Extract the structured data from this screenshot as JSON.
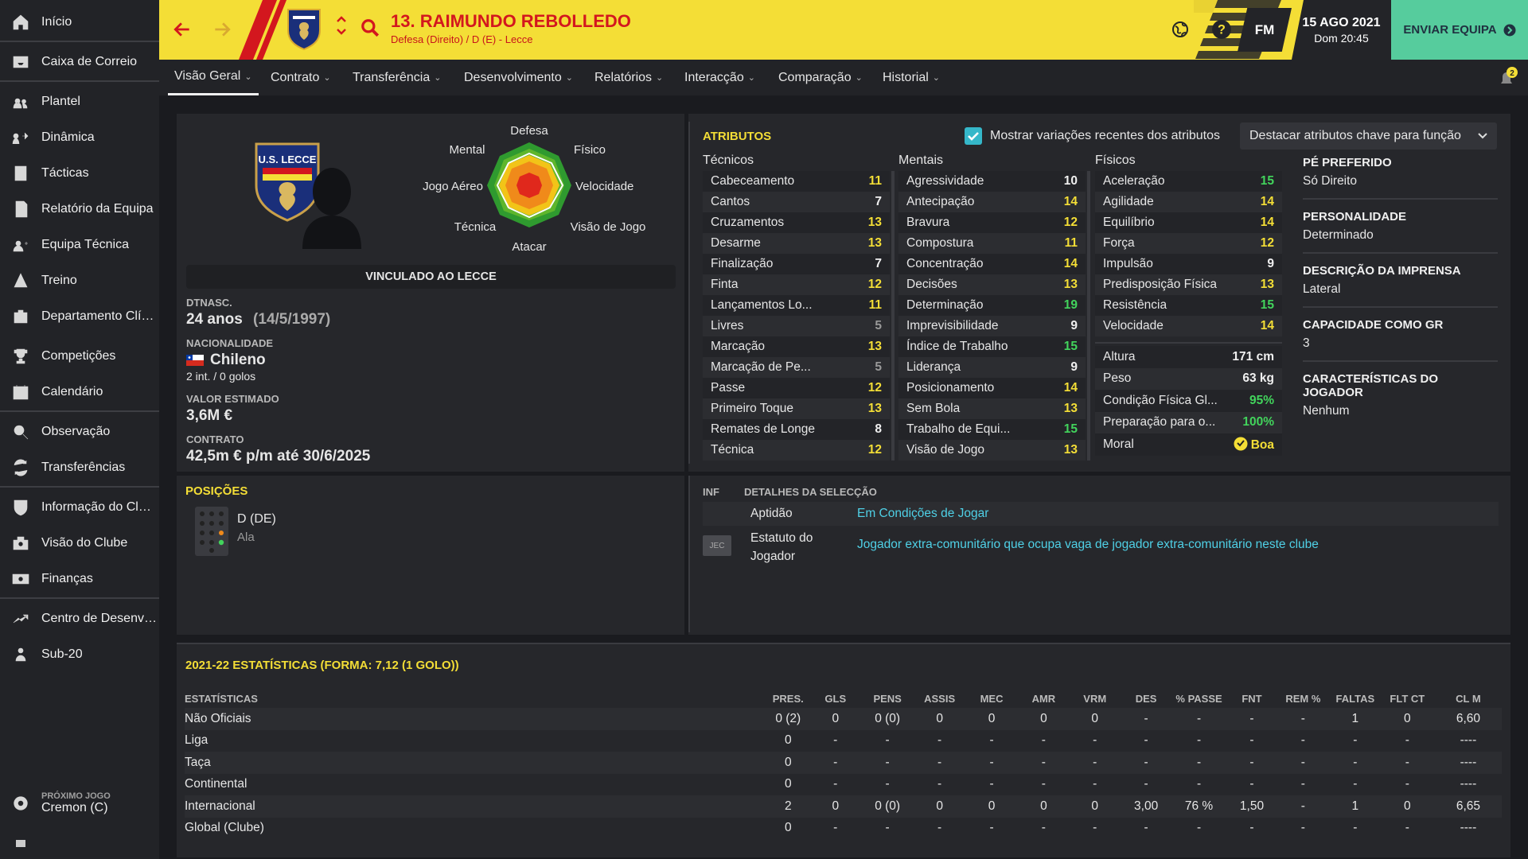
{
  "sidebar": {
    "items": [
      {
        "label": "Início",
        "icon": "home-icon"
      },
      {
        "label": "Caixa de Correio",
        "icon": "inbox-icon"
      },
      {
        "label": "Plantel",
        "icon": "squad-icon"
      },
      {
        "label": "Dinâmica",
        "icon": "dynamics-icon"
      },
      {
        "label": "Tácticas",
        "icon": "tactics-icon"
      },
      {
        "label": "Relatório da Equipa",
        "icon": "report-icon"
      },
      {
        "label": "Equipa Técnica",
        "icon": "staff-icon"
      },
      {
        "label": "Treino",
        "icon": "training-icon"
      },
      {
        "label": "Departamento Clíni...",
        "icon": "medical-icon"
      },
      {
        "label": "Competições",
        "icon": "trophy-icon"
      },
      {
        "label": "Calendário",
        "icon": "calendar-icon"
      },
      {
        "label": "Observação",
        "icon": "scouting-icon"
      },
      {
        "label": "Transferências",
        "icon": "transfers-icon"
      },
      {
        "label": "Informação do Clube",
        "icon": "club-info-icon"
      },
      {
        "label": "Visão do Clube",
        "icon": "club-vision-icon"
      },
      {
        "label": "Finanças",
        "icon": "finances-icon"
      },
      {
        "label": "Centro de Desenvol...",
        "icon": "development-icon"
      },
      {
        "label": "Sub-20",
        "icon": "u20-icon"
      }
    ],
    "next_match_label": "PRÓXIMO JOGO",
    "next_match_opponent": "Cremon (C)"
  },
  "header": {
    "player_title": "13. RAIMUNDO REBOLLEDO",
    "player_subtitle": "Defesa (Direito) / D (E) - Lecce",
    "fm_label": "FM",
    "date": "15 AGO 2021",
    "time": "Dom 20:45",
    "send_label": "ENVIAR EQUIPA",
    "notification_count": "2",
    "accent_color": "#f4de36",
    "title_color": "#d3171e"
  },
  "tabs": [
    {
      "label": "Visão Geral"
    },
    {
      "label": "Contrato"
    },
    {
      "label": "Transferência"
    },
    {
      "label": "Desenvolvimento"
    },
    {
      "label": "Relatórios"
    },
    {
      "label": "Interacção"
    },
    {
      "label": "Comparação"
    },
    {
      "label": "Historial"
    }
  ],
  "profile": {
    "club_crest_text": "U.S. LECCE",
    "status": "VINCULADO AO LECCE",
    "dob_label": "DTNASC.",
    "age": "24 anos",
    "dob": "(14/5/1997)",
    "nationality_label": "NACIONALIDADE",
    "nationality": "Chileno",
    "caps": "2 int. / 0 golos",
    "value_label": "VALOR ESTIMADO",
    "value": "3,6M €",
    "contract_label": "CONTRATO",
    "contract": "42,5m € p/m até 30/6/2025",
    "radar": {
      "top": "Defesa",
      "top_right": "Físico",
      "right": "Velocidade",
      "bottom_right": "Visão de Jogo",
      "bottom": "Atacar",
      "bottom_left": "Técnica",
      "left": "Jogo Aéreo",
      "top_left": "Mental"
    }
  },
  "attributes": {
    "title": "ATRIBUTOS",
    "show_changes_label": "Mostrar variações recentes dos atributos",
    "highlight_label": "Destacar atributos chave para função",
    "technical_title": "Técnicos",
    "mental_title": "Mentais",
    "physical_title": "Físicos",
    "technical": [
      {
        "name": "Cabeceamento",
        "value": "11"
      },
      {
        "name": "Cantos",
        "value": "7"
      },
      {
        "name": "Cruzamentos",
        "value": "13"
      },
      {
        "name": "Desarme",
        "value": "13"
      },
      {
        "name": "Finalização",
        "value": "7"
      },
      {
        "name": "Finta",
        "value": "12"
      },
      {
        "name": "Lançamentos Lo...",
        "value": "11"
      },
      {
        "name": "Livres",
        "value": "5"
      },
      {
        "name": "Marcação",
        "value": "13"
      },
      {
        "name": "Marcação de Pe...",
        "value": "5"
      },
      {
        "name": "Passe",
        "value": "12"
      },
      {
        "name": "Primeiro Toque",
        "value": "13"
      },
      {
        "name": "Remates de Longe",
        "value": "8"
      },
      {
        "name": "Técnica",
        "value": "12"
      }
    ],
    "mental": [
      {
        "name": "Agressividade",
        "value": "10"
      },
      {
        "name": "Antecipação",
        "value": "14"
      },
      {
        "name": "Bravura",
        "value": "12"
      },
      {
        "name": "Compostura",
        "value": "11"
      },
      {
        "name": "Concentração",
        "value": "14"
      },
      {
        "name": "Decisões",
        "value": "13"
      },
      {
        "name": "Determinação",
        "value": "19"
      },
      {
        "name": "Imprevisibilidade",
        "value": "9"
      },
      {
        "name": "Índice de Trabalho",
        "value": "15"
      },
      {
        "name": "Liderança",
        "value": "9"
      },
      {
        "name": "Posicionamento",
        "value": "14"
      },
      {
        "name": "Sem Bola",
        "value": "13"
      },
      {
        "name": "Trabalho de Equi...",
        "value": "15"
      },
      {
        "name": "Visão de Jogo",
        "value": "13"
      }
    ],
    "physical": [
      {
        "name": "Aceleração",
        "value": "15"
      },
      {
        "name": "Agilidade",
        "value": "14"
      },
      {
        "name": "Equilíbrio",
        "value": "14"
      },
      {
        "name": "Força",
        "value": "12"
      },
      {
        "name": "Impulsão",
        "value": "9"
      },
      {
        "name": "Predisposição Física",
        "value": "13"
      },
      {
        "name": "Resistência",
        "value": "15"
      },
      {
        "name": "Velocidade",
        "value": "14"
      }
    ],
    "extra": [
      {
        "name": "Altura",
        "value": "171 cm"
      },
      {
        "name": "Peso",
        "value": "63 kg"
      },
      {
        "name": "Condição Física Gl...",
        "value": "95%"
      },
      {
        "name": "Preparação para o...",
        "value": "100%"
      },
      {
        "name": "Moral",
        "value": "Boa"
      }
    ]
  },
  "info": {
    "preferred_foot_label": "PÉ PREFERIDO",
    "preferred_foot": "Só Direito",
    "personality_label": "PERSONALIDADE",
    "personality": "Determinado",
    "press_label": "DESCRIÇÃO DA IMPRENSA",
    "press": "Lateral",
    "gk_label": "CAPACIDADE COMO GR",
    "gk": "3",
    "traits_label": "CARACTERÍSTICAS DO JOGADOR",
    "traits": "Nenhum"
  },
  "positions": {
    "title": "POSIÇÕES",
    "position": "D (DE)",
    "role": "Ala"
  },
  "selection": {
    "inf_label": "INF",
    "title": "DETALHES DA SELECÇÃO",
    "fitness_label": "Aptidão",
    "fitness_value": "Em Condições de Jogar",
    "status_badge": "JEC",
    "status_label_line1": "Estatuto do",
    "status_label_line2": "Jogador",
    "status_value": "Jogador extra-comunitário que ocupa vaga de jogador extra-comunitário neste clube"
  },
  "stats": {
    "title": "2021-22 ESTATÍSTICAS (FORMA: 7,12 (1 GOLO))",
    "headers": [
      "ESTATÍSTICAS",
      "PRES.",
      "GLS",
      "PENS",
      "ASSIS",
      "MEC",
      "AMR",
      "VRM",
      "DES",
      "% PASSE",
      "FNT",
      "REM %",
      "FALTAS",
      "FLT CT",
      "CL M"
    ],
    "rows": [
      [
        "Não Oficiais",
        "0 (2)",
        "0",
        "0 (0)",
        "0",
        "0",
        "0",
        "0",
        "-",
        "-",
        "-",
        "-",
        "1",
        "0",
        "6,60"
      ],
      [
        "Liga",
        "0",
        "-",
        "-",
        "-",
        "-",
        "-",
        "-",
        "-",
        "-",
        "-",
        "-",
        "-",
        "-",
        "----"
      ],
      [
        "Taça",
        "0",
        "-",
        "-",
        "-",
        "-",
        "-",
        "-",
        "-",
        "-",
        "-",
        "-",
        "-",
        "-",
        "----"
      ],
      [
        "Continental",
        "0",
        "-",
        "-",
        "-",
        "-",
        "-",
        "-",
        "-",
        "-",
        "-",
        "-",
        "-",
        "-",
        "----"
      ],
      [
        "Internacional",
        "2",
        "0",
        "0 (0)",
        "0",
        "0",
        "0",
        "0",
        "3,00",
        "76 %",
        "1,50",
        "-",
        "1",
        "0",
        "6,65"
      ],
      [
        "Global (Clube)",
        "0",
        "-",
        "-",
        "-",
        "-",
        "-",
        "-",
        "-",
        "-",
        "-",
        "-",
        "-",
        "-",
        "----"
      ]
    ]
  }
}
